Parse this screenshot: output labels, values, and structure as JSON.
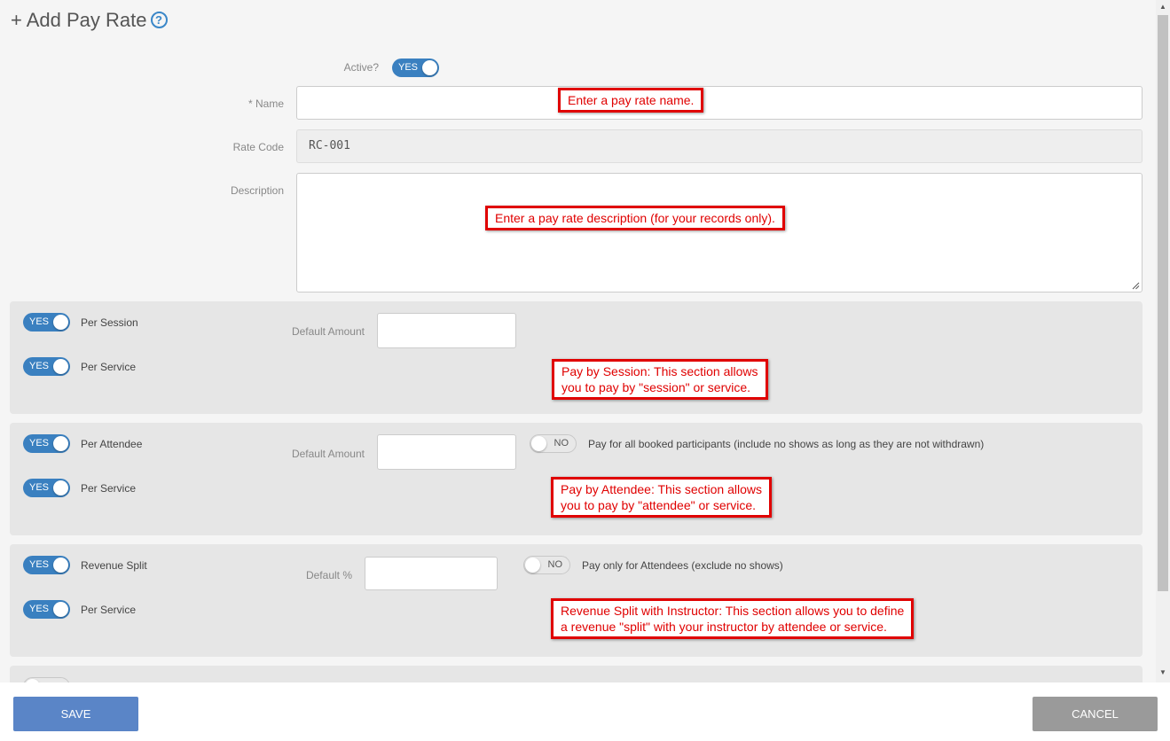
{
  "header": {
    "title": "+ Add Pay Rate",
    "help_icon": "?"
  },
  "form": {
    "active_label": "Active?",
    "active_toggle": "YES",
    "name_label": "* Name",
    "name_value": "",
    "rate_code_label": "Rate Code",
    "rate_code_value": "RC-001",
    "description_label": "Description",
    "description_value": ""
  },
  "callouts": {
    "name": "Enter a pay rate name.",
    "description": "Enter a pay rate description (for your records only).",
    "session_line1": "Pay by Session: This section allows",
    "session_line2": "you to pay by \"session\" or service.",
    "attendee_line1": "Pay by Attendee: This section allows",
    "attendee_line2": "you to pay by \"attendee\" or service.",
    "revenue_line1": "Revenue Split with Instructor: This section allows you to define",
    "revenue_line2": "a revenue \"split\" with your instructor by attendee or service."
  },
  "sections": {
    "session": {
      "toggle1": "YES",
      "label1": "Per Session",
      "toggle2": "YES",
      "label2": "Per Service",
      "amount_label": "Default Amount"
    },
    "attendee": {
      "toggle1": "YES",
      "label1": "Per Attendee",
      "toggle2": "YES",
      "label2": "Per Service",
      "amount_label": "Default Amount",
      "no_toggle": "NO",
      "no_text": "Pay for all booked participants (include no shows as long as they are not withdrawn)"
    },
    "revenue": {
      "toggle1": "YES",
      "label1": "Revenue Split",
      "toggle2": "YES",
      "label2": "Per Service",
      "percent_label": "Default %",
      "no_toggle": "NO",
      "no_text": "Pay only for Attendees (exclude no shows)"
    }
  },
  "footer": {
    "save_label": "SAVE",
    "cancel_label": "CANCEL"
  },
  "colors": {
    "accent": "#3a80c0",
    "callout": "#e00000",
    "save": "#5a85c7",
    "cancel": "#9a9a9a"
  }
}
